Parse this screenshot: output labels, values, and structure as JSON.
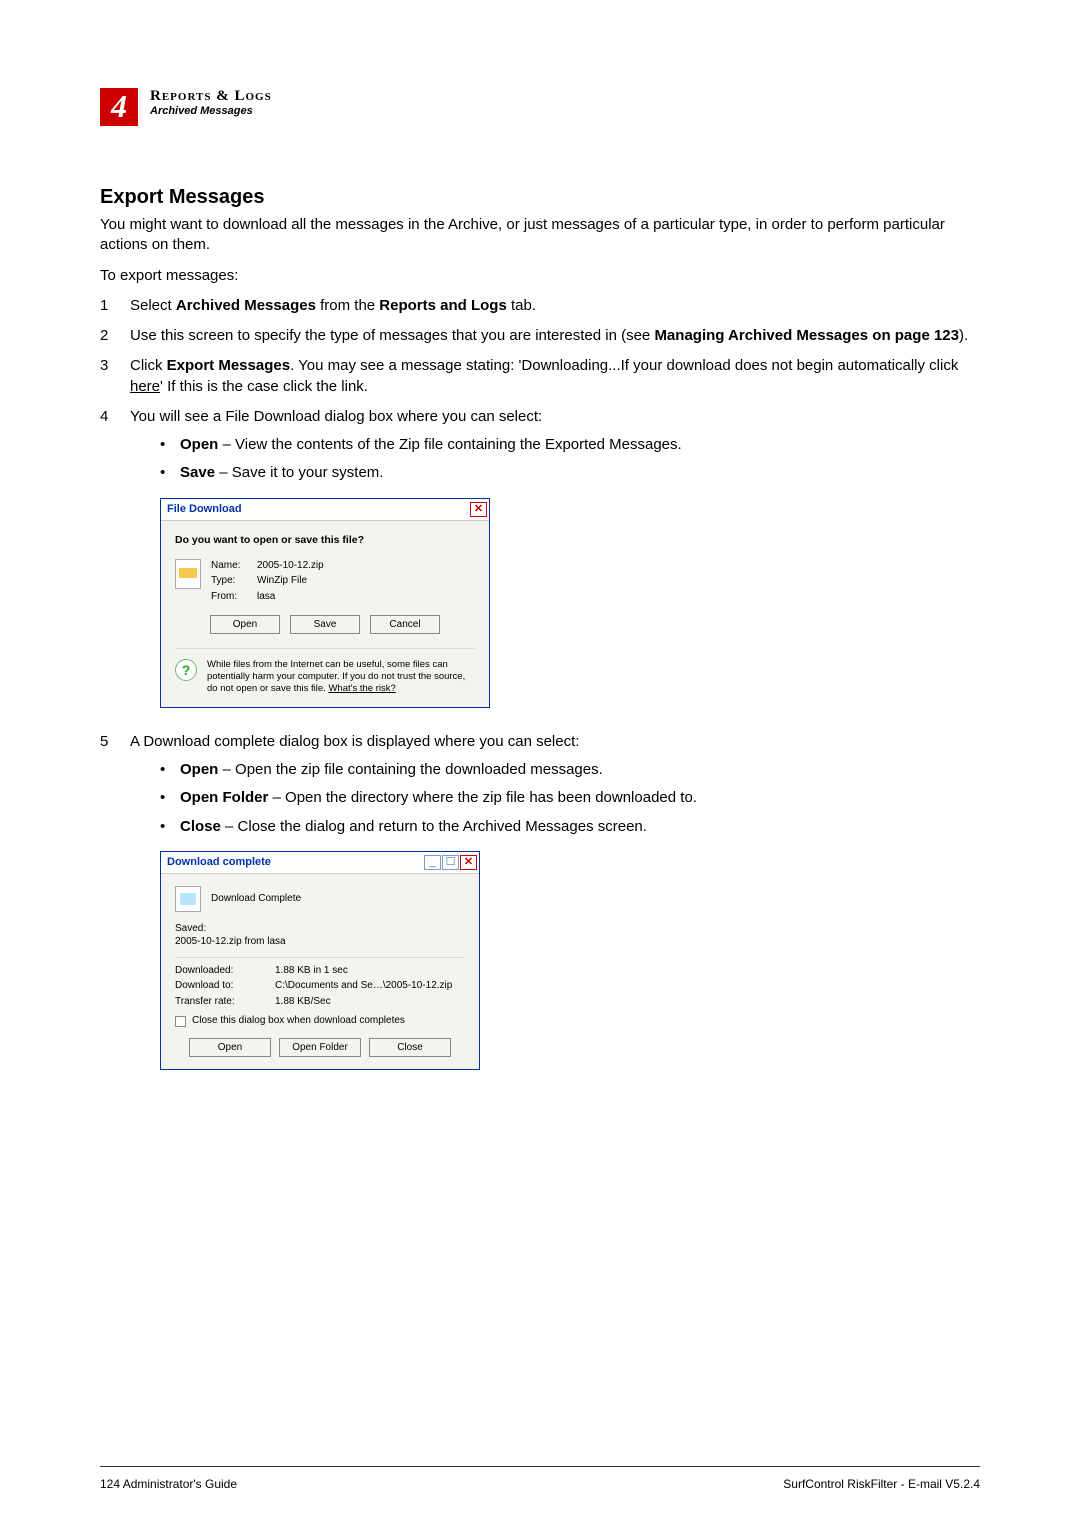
{
  "chapter": {
    "num": "4",
    "title": "Reports & Logs",
    "sub": "Archived Messages"
  },
  "h2": "Export Messages",
  "intro": "You might want to download all the messages in the Archive, or just messages of a particular type, in order to perform particular actions on them.",
  "lead": "To export messages:",
  "steps": {
    "s1a": "Select ",
    "s1b": "Archived Messages",
    "s1c": " from the ",
    "s1d": "Reports and Logs",
    "s1e": " tab.",
    "s2a": "Use this screen to specify the type of messages that you are interested in (see ",
    "s2b": "Managing Archived Messages on page 123",
    "s2c": ").",
    "s3a": "Click ",
    "s3b": "Export Messages",
    "s3c": ". You may see a message stating: 'Downloading...If your download does not begin automatically click ",
    "s3d": "here",
    "s3e": "' If this is the case click the link.",
    "s4": "You will see a File Download dialog box where you can select:",
    "s4o1a": "Open",
    "s4o1b": " – View the contents of the Zip file containing the Exported Messages.",
    "s4o2a": "Save",
    "s4o2b": " – Save it to your system.",
    "s5": "A Download complete dialog box is displayed where you can select:",
    "s5o1a": "Open",
    "s5o1b": " – Open the zip file containing the downloaded messages.",
    "s5o2a": "Open Folder",
    "s5o2b": " – Open the directory where the zip file has been downloaded to.",
    "s5o3a": "Close",
    "s5o3b": " – Close the dialog and return to the Archived Messages screen."
  },
  "dlg1": {
    "title": "File Download",
    "q": "Do you want to open or save this file?",
    "kv": {
      "nameL": "Name:",
      "nameV": "2005-10-12.zip",
      "typeL": "Type:",
      "typeV": "WinZip File",
      "fromL": "From:",
      "fromV": "lasa"
    },
    "btnOpen": "Open",
    "btnSave": "Save",
    "btnCancel": "Cancel",
    "warn1": "While files from the Internet can be useful, some files can potentially harm your computer. If you do not trust the source, do not open or save this file. ",
    "warn2": "What's the risk?"
  },
  "dlg2": {
    "title": "Download complete",
    "h": "Download Complete",
    "savedL": "Saved:",
    "saved": "2005-10-12.zip from lasa",
    "kv": {
      "dlL": "Downloaded:",
      "dlV": "1.88 KB in 1 sec",
      "toL": "Download to:",
      "toV": "C:\\Documents and Se…\\2005-10-12.zip",
      "trL": "Transfer rate:",
      "trV": "1.88 KB/Sec"
    },
    "chk": "Close this dialog box when download completes",
    "btnOpen": "Open",
    "btnFolder": "Open Folder",
    "btnClose": "Close"
  },
  "footer": {
    "left": "124  Administrator's Guide",
    "right": "SurfControl RiskFilter - E-mail V5.2.4"
  }
}
